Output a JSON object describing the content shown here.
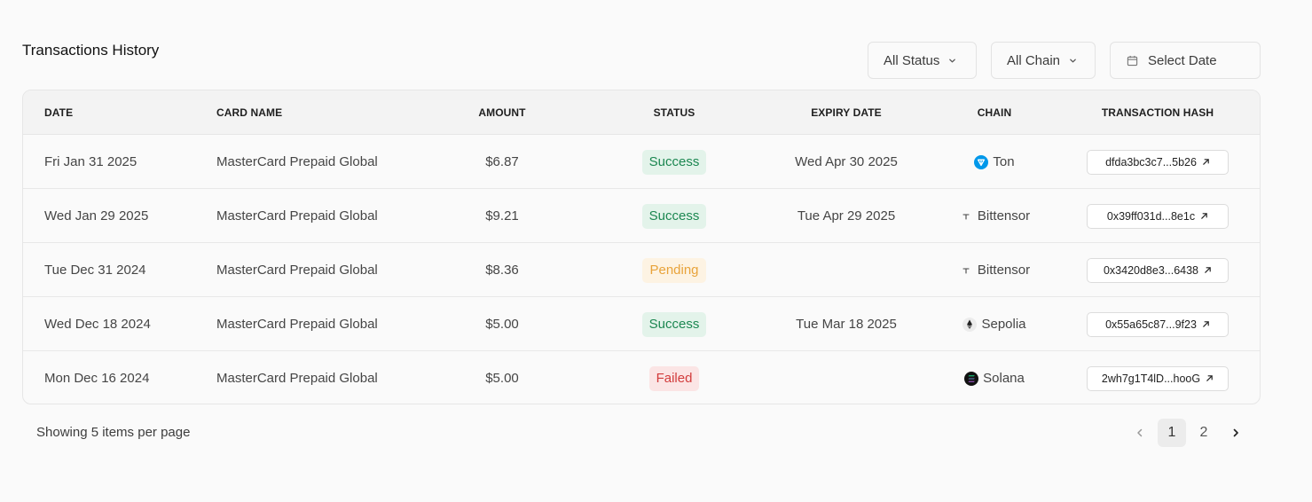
{
  "header": {
    "title": "Transactions History"
  },
  "filters": {
    "status_label": "All Status",
    "chain_label": "All Chain",
    "date_placeholder": "Select Date"
  },
  "table": {
    "columns": [
      "DATE",
      "CARD NAME",
      "AMOUNT",
      "STATUS",
      "EXPIRY DATE",
      "CHAIN",
      "TRANSACTION HASH"
    ],
    "rows": [
      {
        "date": "Fri Jan 31 2025",
        "card": "MasterCard Prepaid Global",
        "amount": "$6.87",
        "status": "Success",
        "expiry": "Wed Apr 30 2025",
        "chain": "Ton",
        "chain_icon": "ton-icon",
        "hash": "dfda3bc3c7...5b26"
      },
      {
        "date": "Wed Jan 29 2025",
        "card": "MasterCard Prepaid Global",
        "amount": "$9.21",
        "status": "Success",
        "expiry": "Tue Apr 29 2025",
        "chain": "Bittensor",
        "chain_icon": "bittensor-icon",
        "hash": "0x39ff031d...8e1c"
      },
      {
        "date": "Tue Dec 31 2024",
        "card": "MasterCard Prepaid Global",
        "amount": "$8.36",
        "status": "Pending",
        "expiry": "",
        "chain": "Bittensor",
        "chain_icon": "bittensor-icon",
        "hash": "0x3420d8e3...6438"
      },
      {
        "date": "Wed Dec 18 2024",
        "card": "MasterCard Prepaid Global",
        "amount": "$5.00",
        "status": "Success",
        "expiry": "Tue Mar 18 2025",
        "chain": "Sepolia",
        "chain_icon": "ethereum-icon",
        "hash": "0x55a65c87...9f23"
      },
      {
        "date": "Mon Dec 16 2024",
        "card": "MasterCard Prepaid Global",
        "amount": "$5.00",
        "status": "Failed",
        "expiry": "",
        "chain": "Solana",
        "chain_icon": "solana-icon",
        "hash": "2wh7g1T4lD...hooG"
      }
    ]
  },
  "footer": {
    "items_per_page_text": "Showing 5 items per page"
  },
  "pagination": {
    "pages": [
      "1",
      "2"
    ],
    "current": "1"
  },
  "colors": {
    "success_bg": "#e3f3ea",
    "success_text": "#1c8751",
    "pending_bg": "#fdf3e3",
    "pending_text": "#e8a33a",
    "failed_bg": "#fbe5e5",
    "failed_text": "#d23c3c"
  }
}
